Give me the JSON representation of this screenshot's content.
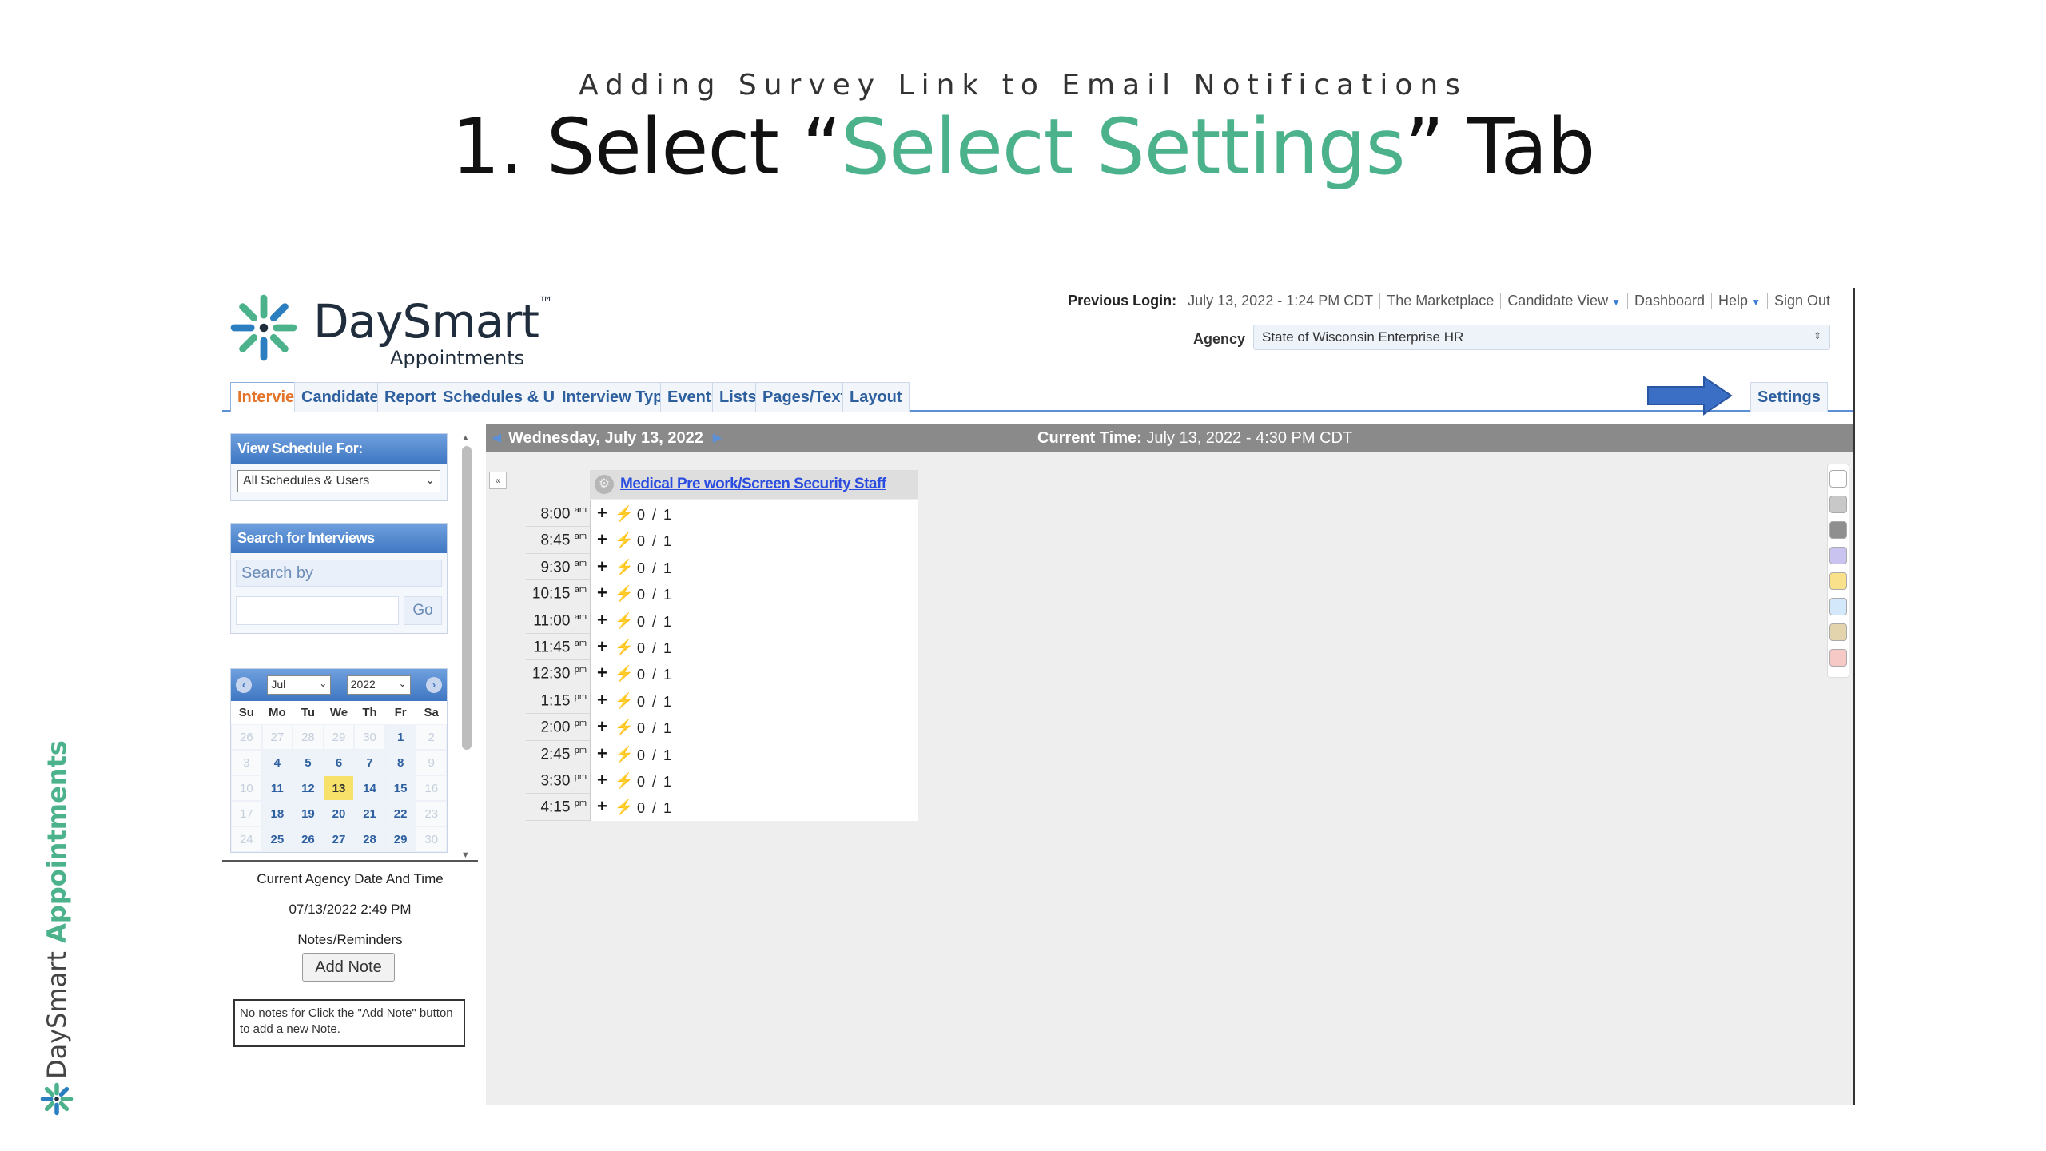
{
  "slide": {
    "subtitle": "Adding Survey Link to Email Notifications",
    "title_prefix": "1. Select “",
    "title_highlight": "Select Settings",
    "title_suffix": "” Tab",
    "vertical_brand_main": "DaySmart ",
    "vertical_brand_accent": "Appointments",
    "accent_color": "#4cb28c"
  },
  "app": {
    "brand": {
      "name": "DaySmart",
      "tm": "™",
      "sub": "Appointments"
    },
    "toplinks": {
      "previous_login_label": "Previous Login:",
      "previous_login_value": "July 13, 2022 - 1:24 PM CDT",
      "marketplace": "The Marketplace",
      "candidate_view": "Candidate View",
      "dashboard": "Dashboard",
      "help": "Help",
      "sign_out": "Sign Out"
    },
    "agency": {
      "label": "Agency",
      "value": "State of Wisconsin Enterprise HR"
    },
    "tabs": [
      {
        "label": "Interviews",
        "active": true
      },
      {
        "label": "Candidates"
      },
      {
        "label": "Reports"
      },
      {
        "label": "Schedules & Users"
      },
      {
        "label": "Interview Types"
      },
      {
        "label": "Events"
      },
      {
        "label": "Lists"
      },
      {
        "label": "Pages/Text"
      },
      {
        "label": "Layout"
      }
    ],
    "settings_tab": "Settings",
    "arrow_color": "#3b6fc6",
    "sidebar": {
      "view_schedule_title": "View Schedule For:",
      "view_schedule_value": "All Schedules & Users",
      "search_title": "Search for Interviews",
      "search_by_placeholder": "Search by",
      "go_label": "Go",
      "calendar": {
        "month": "Jul",
        "year": "2022",
        "dow": [
          "Su",
          "Mo",
          "Tu",
          "We",
          "Th",
          "Fr",
          "Sa"
        ],
        "days": [
          {
            "d": "26",
            "m": true
          },
          {
            "d": "27",
            "m": true
          },
          {
            "d": "28",
            "m": true
          },
          {
            "d": "29",
            "m": true
          },
          {
            "d": "30",
            "m": true
          },
          {
            "d": "1"
          },
          {
            "d": "2",
            "m": true
          },
          {
            "d": "3",
            "m": true
          },
          {
            "d": "4"
          },
          {
            "d": "5"
          },
          {
            "d": "6"
          },
          {
            "d": "7"
          },
          {
            "d": "8"
          },
          {
            "d": "9",
            "m": true
          },
          {
            "d": "10",
            "m": true
          },
          {
            "d": "11"
          },
          {
            "d": "12"
          },
          {
            "d": "13",
            "today": true
          },
          {
            "d": "14"
          },
          {
            "d": "15"
          },
          {
            "d": "16",
            "m": true
          },
          {
            "d": "17",
            "m": true
          },
          {
            "d": "18"
          },
          {
            "d": "19"
          },
          {
            "d": "20"
          },
          {
            "d": "21"
          },
          {
            "d": "22"
          },
          {
            "d": "23",
            "m": true
          },
          {
            "d": "24",
            "m": true
          },
          {
            "d": "25"
          },
          {
            "d": "26"
          },
          {
            "d": "27"
          },
          {
            "d": "28"
          },
          {
            "d": "29"
          },
          {
            "d": "30",
            "m": true
          }
        ]
      },
      "agency_datetime_label": "Current Agency Date And Time",
      "agency_datetime": "07/13/2022 2:49 PM",
      "notes_label": "Notes/Reminders",
      "add_note": "Add Note",
      "notes_text": "No notes for Click the \"Add Note\" button to add a new Note."
    },
    "main": {
      "date": "Wednesday, July 13, 2022",
      "current_time_label": "Current Time:",
      "current_time_value": " July 13, 2022 - 4:30 PM CDT",
      "schedule_name": "Medical Pre work/Screen Security Staff",
      "slots": [
        {
          "time": "8:00",
          "ampm": "am",
          "count": "0 / 1"
        },
        {
          "time": "8:45",
          "ampm": "am",
          "count": "0 / 1"
        },
        {
          "time": "9:30",
          "ampm": "am",
          "count": "0 / 1"
        },
        {
          "time": "10:15",
          "ampm": "am",
          "count": "0 / 1"
        },
        {
          "time": "11:00",
          "ampm": "am",
          "count": "0 / 1"
        },
        {
          "time": "11:45",
          "ampm": "am",
          "count": "0 / 1"
        },
        {
          "time": "12:30",
          "ampm": "pm",
          "count": "0 / 1"
        },
        {
          "time": "1:15",
          "ampm": "pm",
          "count": "0 / 1"
        },
        {
          "time": "2:00",
          "ampm": "pm",
          "count": "0 / 1"
        },
        {
          "time": "2:45",
          "ampm": "pm",
          "count": "0 / 1"
        },
        {
          "time": "3:30",
          "ampm": "pm",
          "count": "0 / 1"
        },
        {
          "time": "4:15",
          "ampm": "pm",
          "count": "0 / 1"
        }
      ],
      "swatches": [
        "#ffffff",
        "#c8c8c8",
        "#8f8f8f",
        "#c9c3ef",
        "#f9e08a",
        "#d3e8fb",
        "#e3d4ae",
        "#f6c9c6"
      ]
    }
  }
}
